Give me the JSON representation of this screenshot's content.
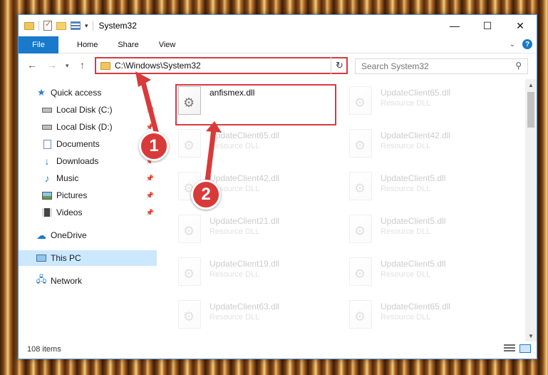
{
  "window": {
    "title": "System32"
  },
  "ribbon": {
    "tabs": [
      "File",
      "Home",
      "Share",
      "View"
    ]
  },
  "address": {
    "path": "C:\\Windows\\System32",
    "search_placeholder": "Search System32"
  },
  "sidebar": {
    "items": [
      {
        "label": "Quick access",
        "icon": "star-icon"
      },
      {
        "label": "Local Disk (C:)",
        "icon": "drive-icon"
      },
      {
        "label": "Local Disk (D:)",
        "icon": "drive-icon"
      },
      {
        "label": "Documents",
        "icon": "documents-icon"
      },
      {
        "label": "Downloads",
        "icon": "download-icon"
      },
      {
        "label": "Music",
        "icon": "music-icon"
      },
      {
        "label": "Pictures",
        "icon": "pictures-icon"
      },
      {
        "label": "Videos",
        "icon": "videos-icon"
      },
      {
        "label": "OneDrive",
        "icon": "cloud-icon"
      },
      {
        "label": "This PC",
        "icon": "computer-icon"
      },
      {
        "label": "Network",
        "icon": "network-icon"
      }
    ]
  },
  "files": [
    {
      "name": "anfismex.dll",
      "desc": ""
    },
    {
      "name": "UpdateClient65.dll",
      "desc": "Resource DLL"
    },
    {
      "name": "UpdateClient65.dll",
      "desc": "Resource DLL"
    },
    {
      "name": "UpdateClient42.dll",
      "desc": "Resource DLL"
    },
    {
      "name": "UpdateClient42.dll",
      "desc": "Resource DLL"
    },
    {
      "name": "UpdateClient5.dll",
      "desc": "Resource DLL"
    },
    {
      "name": "UpdateClient21.dll",
      "desc": "Resource DLL"
    },
    {
      "name": "UpdateClient5.dll",
      "desc": "Resource DLL"
    },
    {
      "name": "UpdateClient19.dll",
      "desc": "Resource DLL"
    },
    {
      "name": "UpdateClient5.dll",
      "desc": "Resource DLL"
    },
    {
      "name": "UpdateClient63.dll",
      "desc": "Resource DLL"
    },
    {
      "name": "UpdateClient65.dll",
      "desc": "Resource DLL"
    }
  ],
  "status": {
    "count": "108 items"
  },
  "callouts": [
    "1",
    "2"
  ],
  "colors": {
    "accent": "#1979ca",
    "highlight": "#d9393e",
    "callout": "#d83a3a"
  }
}
